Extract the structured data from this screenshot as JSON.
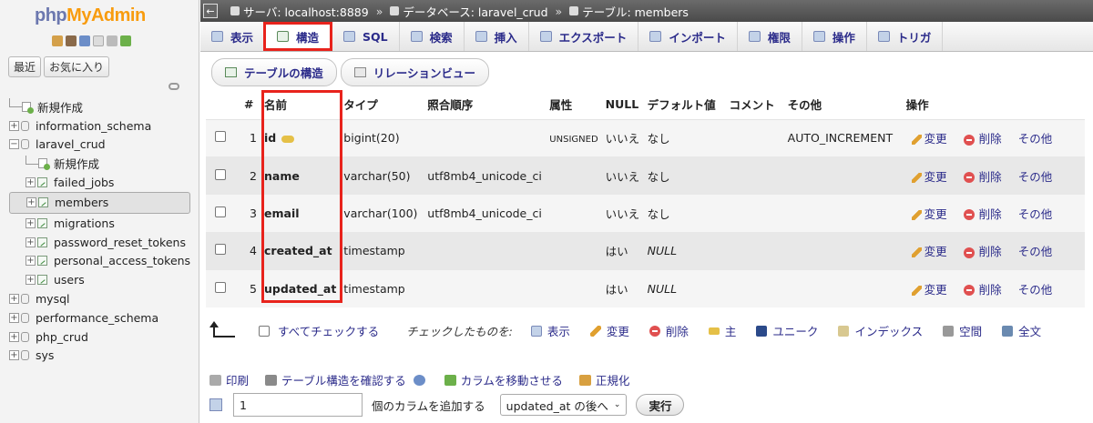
{
  "sidebar": {
    "logo_left": "php",
    "logo_right": "MyAdmin",
    "recent": "最近",
    "favorites": "お気に入り",
    "tree": [
      {
        "label": "新規作成",
        "kind": "new",
        "level": 0
      },
      {
        "label": "information_schema",
        "kind": "db",
        "level": 0,
        "exp": "+"
      },
      {
        "label": "laravel_crud",
        "kind": "db",
        "level": 0,
        "exp": "−"
      },
      {
        "label": "新規作成",
        "kind": "new",
        "level": 1
      },
      {
        "label": "failed_jobs",
        "kind": "tbl",
        "level": 1,
        "exp": "+"
      },
      {
        "label": "members",
        "kind": "tbl",
        "level": 1,
        "exp": "+",
        "selected": true
      },
      {
        "label": "migrations",
        "kind": "tbl",
        "level": 1,
        "exp": "+"
      },
      {
        "label": "password_reset_tokens",
        "kind": "tbl",
        "level": 1,
        "exp": "+"
      },
      {
        "label": "personal_access_tokens",
        "kind": "tbl",
        "level": 1,
        "exp": "+"
      },
      {
        "label": "users",
        "kind": "tbl",
        "level": 1,
        "exp": "+"
      },
      {
        "label": "mysql",
        "kind": "db",
        "level": 0,
        "exp": "+"
      },
      {
        "label": "performance_schema",
        "kind": "db",
        "level": 0,
        "exp": "+"
      },
      {
        "label": "php_crud",
        "kind": "db",
        "level": 0,
        "exp": "+"
      },
      {
        "label": "sys",
        "kind": "db",
        "level": 0,
        "exp": "+"
      }
    ]
  },
  "breadcrumb": {
    "server": "サーバ: localhost:8889",
    "database": "データベース: laravel_crud",
    "table": "テーブル: members"
  },
  "tabs": [
    "表示",
    "構造",
    "SQL",
    "検索",
    "挿入",
    "エクスポート",
    "インポート",
    "権限",
    "操作",
    "トリガ"
  ],
  "subtabs": {
    "structure": "テーブルの構造",
    "relation": "リレーションビュー"
  },
  "columns": [
    "#",
    "名前",
    "タイプ",
    "照合順序",
    "属性",
    "NULL",
    "デフォルト値",
    "コメント",
    "その他",
    "操作"
  ],
  "rows": [
    {
      "num": "1",
      "name": "id",
      "type": "bigint(20)",
      "collation": "",
      "attr": "UNSIGNED",
      "null": "いいえ",
      "default": "なし",
      "extra": "AUTO_INCREMENT",
      "key": true
    },
    {
      "num": "2",
      "name": "name",
      "type": "varchar(50)",
      "collation": "utf8mb4_unicode_ci",
      "attr": "",
      "null": "いいえ",
      "default": "なし",
      "extra": ""
    },
    {
      "num": "3",
      "name": "email",
      "type": "varchar(100)",
      "collation": "utf8mb4_unicode_ci",
      "attr": "",
      "null": "いいえ",
      "default": "なし",
      "extra": ""
    },
    {
      "num": "4",
      "name": "created_at",
      "type": "timestamp",
      "collation": "",
      "attr": "",
      "null": "はい",
      "default": "NULL",
      "extra": ""
    },
    {
      "num": "5",
      "name": "updated_at",
      "type": "timestamp",
      "collation": "",
      "attr": "",
      "null": "はい",
      "default": "NULL",
      "extra": ""
    }
  ],
  "row_actions": {
    "change": "変更",
    "drop": "削除",
    "more": "その他"
  },
  "bulk": {
    "check_all": "すべてチェックする",
    "with_selected": "チェックしたものを:",
    "browse": "表示",
    "change": "変更",
    "drop": "削除",
    "primary": "主",
    "unique": "ユニーク",
    "index": "インデックス",
    "spatial": "空間",
    "fulltext": "全文"
  },
  "footer": {
    "print": "印刷",
    "propose": "テーブル構造を確認する",
    "move": "カラムを移動させる",
    "normalize": "正規化",
    "add_count": "1",
    "add_label": "個のカラムを追加する",
    "position": "updated_at の後へ",
    "go": "実行"
  },
  "colors": {
    "highlight": "#e8231c",
    "link": "#2b2b8a",
    "breadcrumb_bg": "#4a4a4a"
  }
}
